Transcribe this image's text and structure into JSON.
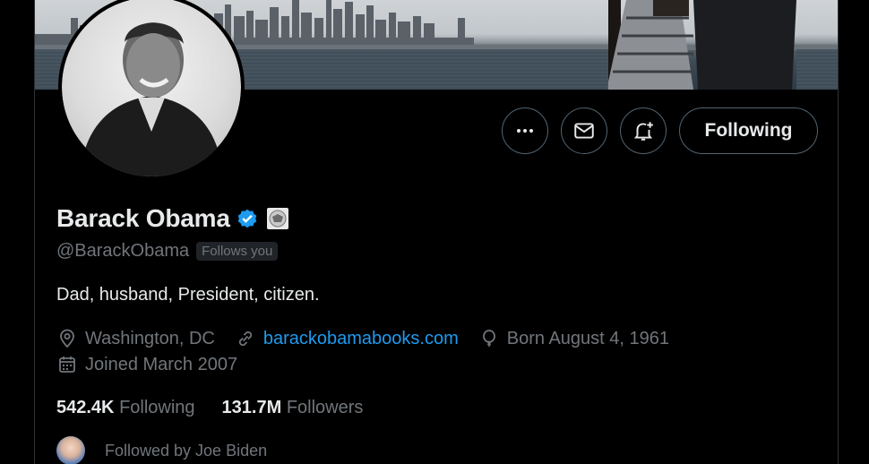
{
  "profile": {
    "name": "Barack Obama",
    "handle": "@BarackObama",
    "follows_you": "Follows you",
    "bio": "Dad, husband, President, citizen.",
    "location": "Washington, DC",
    "website": "barackobamabooks.com",
    "born": "Born August 4, 1961",
    "joined": "Joined March 2007"
  },
  "stats": {
    "following_count": "542.4K",
    "following_label": "Following",
    "followers_count": "131.7M",
    "followers_label": "Followers"
  },
  "followed_by": "Followed by Joe Biden",
  "actions": {
    "following_label": "Following"
  },
  "colors": {
    "accent": "#1d9bf0",
    "verified": "#1d9bf0",
    "muted_text": "#71767b",
    "border": "#536471"
  },
  "icons": [
    "more-icon",
    "mail-icon",
    "bell-plus-icon",
    "verified-badge-icon",
    "government-seal-icon",
    "location-icon",
    "link-icon",
    "balloon-icon",
    "calendar-icon"
  ]
}
